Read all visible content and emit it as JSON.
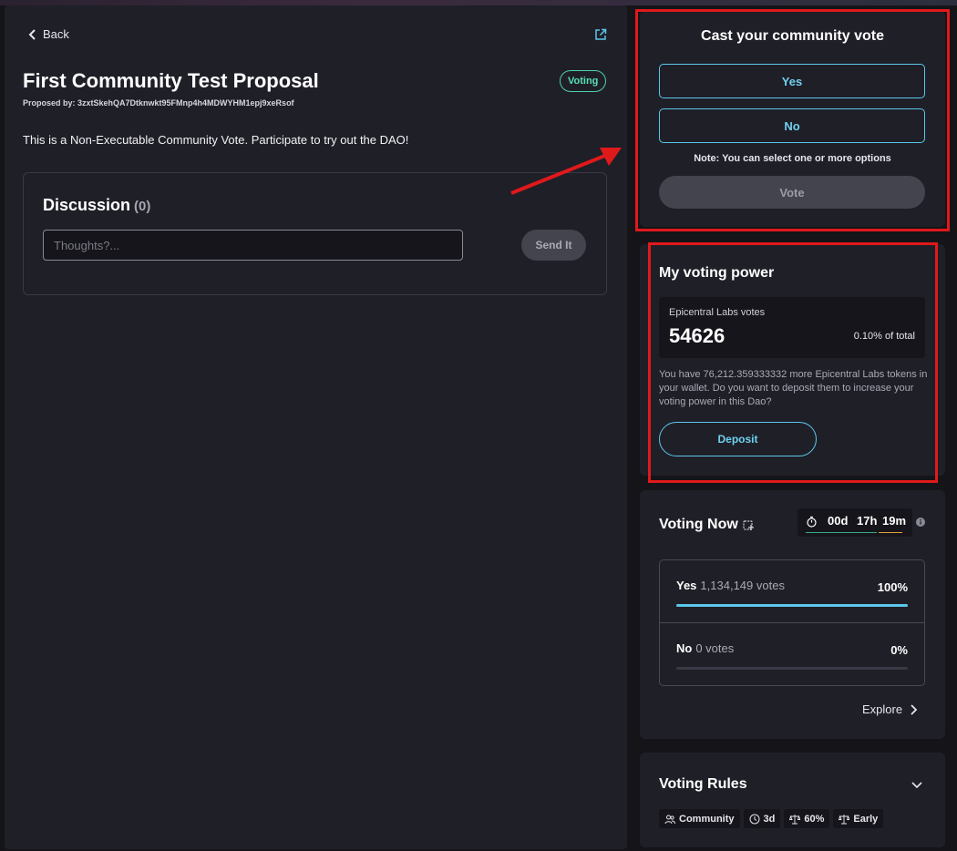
{
  "nav": {
    "back_label": "Back"
  },
  "proposal": {
    "title": "First Community Test Proposal",
    "status": "Voting",
    "proposed_by": "Proposed by: 3zxtSkehQA7Dtknwkt95FMnp4h4MDWYHM1epj9xeRsof",
    "description": "This is a Non-Executable Community Vote. Participate to try out the DAO!"
  },
  "discussion": {
    "title": "Discussion",
    "count": "(0)",
    "input_placeholder": "Thoughts?...",
    "send_label": "Send It"
  },
  "cast_vote": {
    "heading": "Cast your community vote",
    "options": [
      "Yes",
      "No"
    ],
    "note": "Note: You can select one or more options",
    "vote_label": "Vote"
  },
  "voting_power": {
    "heading": "My voting power",
    "label": "Epicentral Labs votes",
    "value": "54626",
    "percent_of_total": "0.10% of total",
    "wallet_text": "You have 76,212.359333332 more Epicentral Labs tokens in your wallet. Do you want to deposit them to increase your voting power in this Dao?",
    "deposit_label": "Deposit"
  },
  "voting_now": {
    "heading": "Voting Now",
    "timer": {
      "days": "00d",
      "hours": "17h",
      "minutes": "19m"
    },
    "results": [
      {
        "name": "Yes",
        "votes": "1,134,149 votes",
        "percent": "100%",
        "fraction": 1.0
      },
      {
        "name": "No",
        "votes": "0 votes",
        "percent": "0%",
        "fraction": 0.0
      }
    ],
    "explore_label": "Explore"
  },
  "voting_rules": {
    "heading": "Voting Rules",
    "chips": [
      {
        "label": "Community",
        "icon": "users-icon"
      },
      {
        "label": "3d",
        "icon": "clock-icon"
      },
      {
        "label": "60%",
        "icon": "scale-icon"
      },
      {
        "label": "Early",
        "icon": "scale-icon"
      }
    ]
  },
  "colors": {
    "accent": "#5cc7e8",
    "status_green": "#57e0b3",
    "annotation_red": "#e0191b",
    "panel": "#1f1f28",
    "background": "#141419"
  }
}
